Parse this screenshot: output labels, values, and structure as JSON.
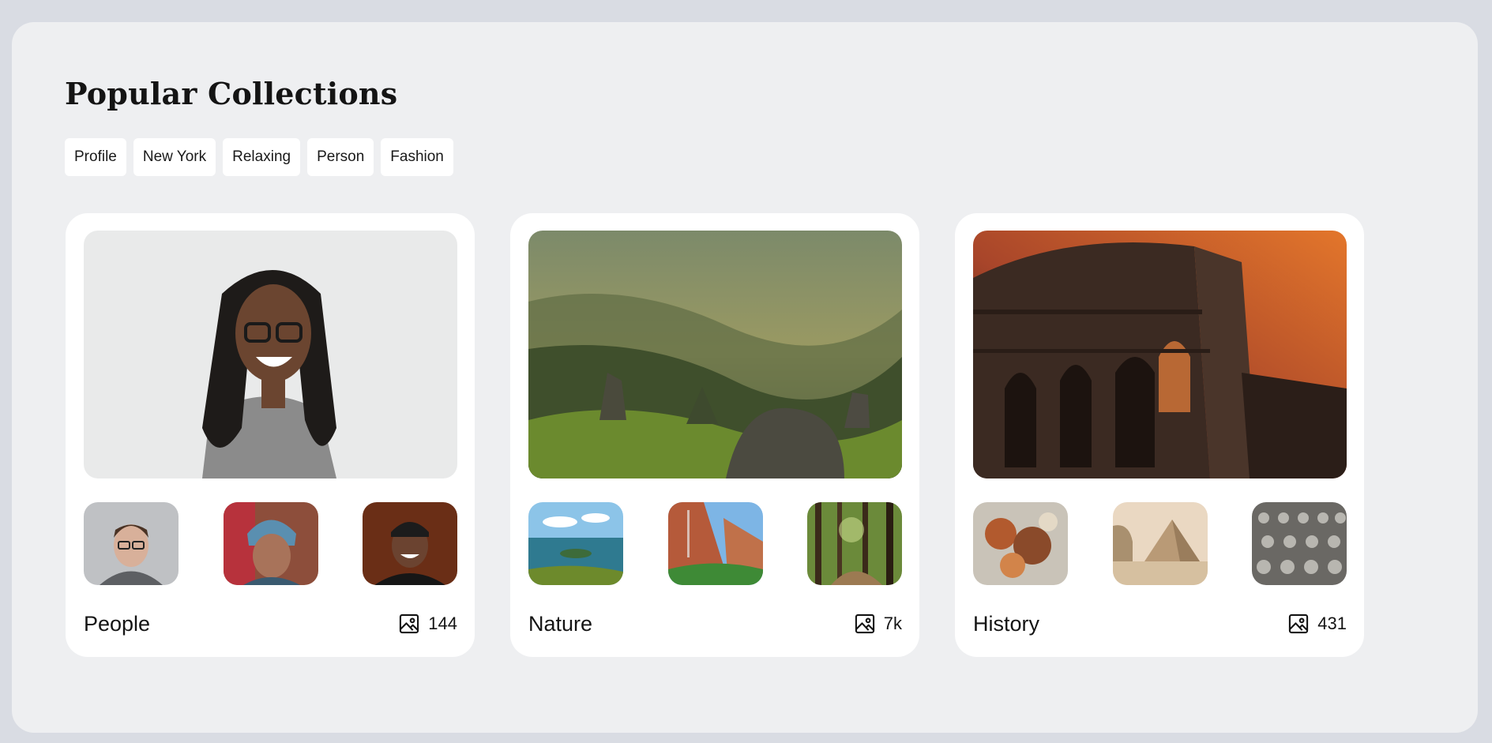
{
  "page": {
    "title": "Popular Collections"
  },
  "tags": [
    "Profile",
    "New York",
    "Relaxing",
    "Person",
    "Fashion"
  ],
  "collections": [
    {
      "name": "People",
      "count": "144",
      "icon": "image-icon"
    },
    {
      "name": "Nature",
      "count": "7k",
      "icon": "image-icon"
    },
    {
      "name": "History",
      "count": "431",
      "icon": "image-icon"
    }
  ],
  "colors": {
    "background": "#d9dce3",
    "panel": "#eeeff1",
    "card": "#ffffff",
    "text": "#141414"
  }
}
